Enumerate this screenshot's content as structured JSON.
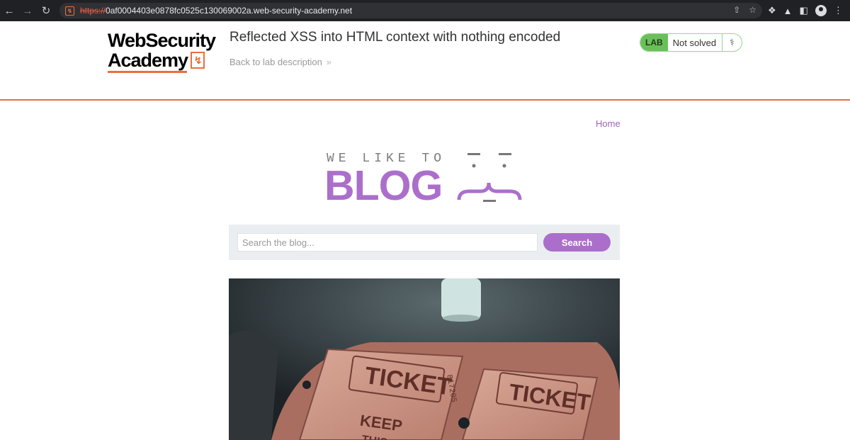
{
  "browser": {
    "url_scheme": "https://",
    "url_host": "0af0004403e0878fc0525c130069002a.web-security-academy.net"
  },
  "academy": {
    "logo_line1": "WebSecurity",
    "logo_line2": "Academy",
    "lab_title": "Reflected XSS into HTML context with nothing encoded",
    "back_link": "Back to lab description",
    "lab_badge": "LAB",
    "lab_status": "Not solved"
  },
  "blog": {
    "nav_home": "Home",
    "logo_top": "WE LIKE TO",
    "logo_main": "BLOG",
    "search_placeholder": "Search the blog...",
    "search_button": "Search"
  },
  "post_image": {
    "ticket_text_1": "TICKET",
    "ticket_text_2": "TICKET",
    "ticket_text_3": "KEEP",
    "ticket_text_4": "THIS",
    "ticket_number": "817205"
  },
  "colors": {
    "accent": "#ab6fcb",
    "academy_orange": "#e8703a",
    "lab_green": "#6bbf5a"
  }
}
